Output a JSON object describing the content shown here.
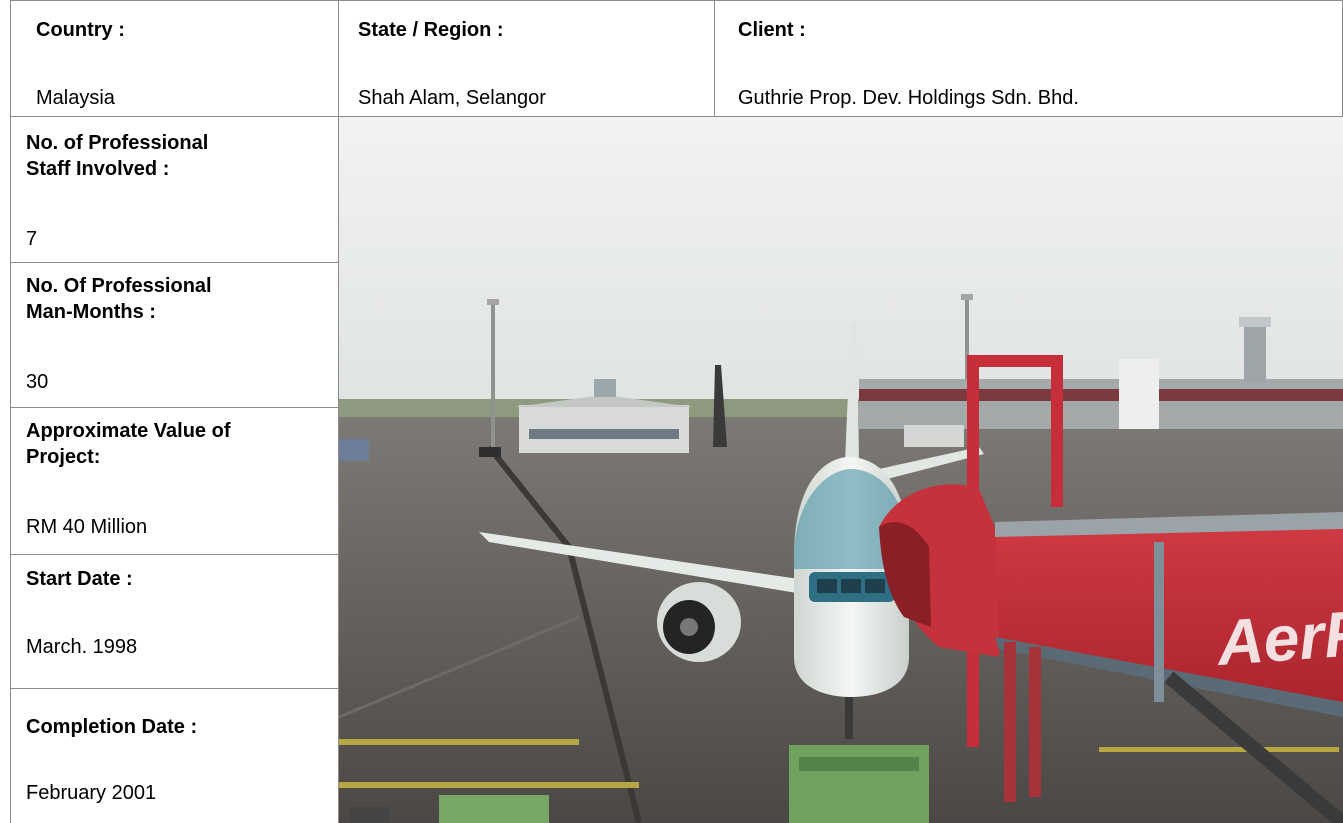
{
  "header": {
    "country_label": "Country :",
    "country_value": "Malaysia",
    "state_label": "State / Region :",
    "state_value": "Shah Alam, Selangor",
    "client_label": "Client :",
    "client_value": "Guthrie Prop. Dev. Holdings Sdn. Bhd."
  },
  "details": [
    {
      "label_line1": "No. of Professional",
      "label_line2": "Staff Involved :",
      "value": "7"
    },
    {
      "label_line1": "No. Of Professional",
      "label_line2": "Man-Months :",
      "value": "30"
    },
    {
      "label_line1": "Approximate Value of",
      "label_line2": "Project:",
      "value": "RM 40 Million"
    },
    {
      "label_line1": "Start Date :",
      "value": "March. 1998"
    },
    {
      "label_line1": "Completion Date :",
      "value": "February 2001"
    }
  ],
  "photo": {
    "jetbridge_lettering": "AerF",
    "colors": {
      "sky": "#e6e8e6",
      "tarmac": "#5d5a57",
      "jetbridge": "#c8303a",
      "aircraft": "#eef0ee",
      "stripe": "#2d8aa8"
    }
  }
}
